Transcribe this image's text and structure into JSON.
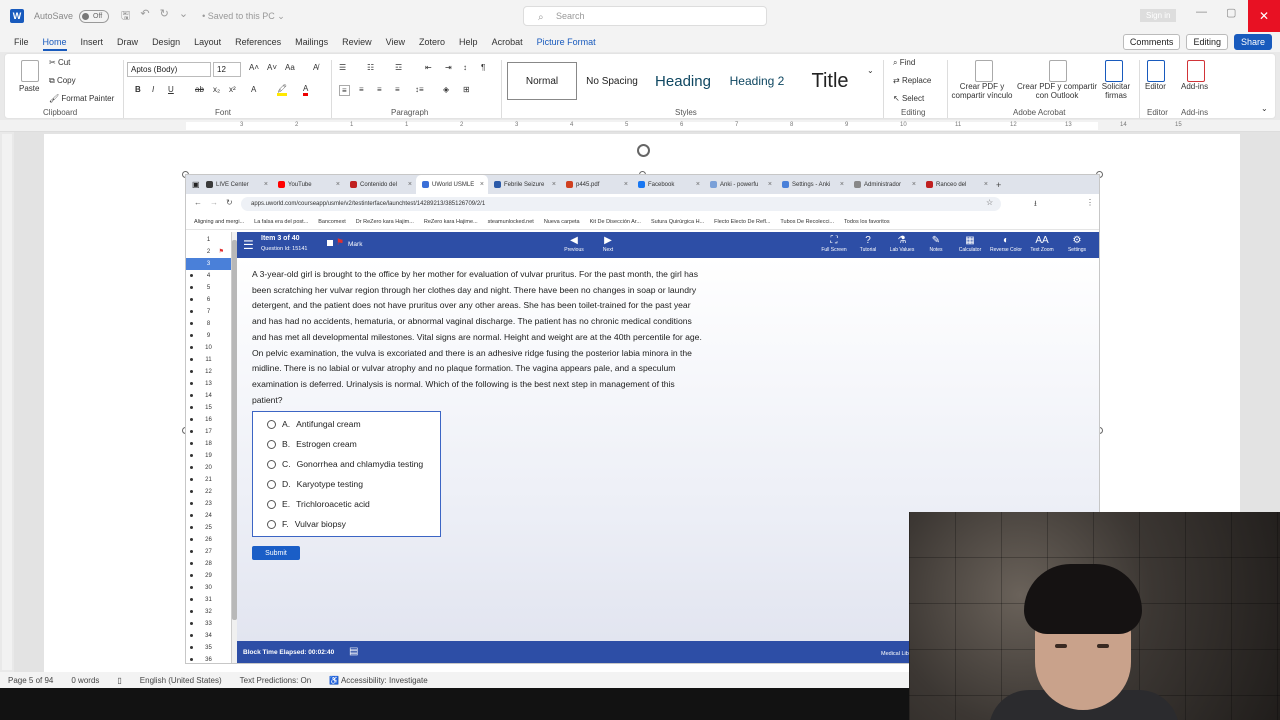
{
  "titlebar": {
    "autosave_label": "AutoSave",
    "toggle_state": "Off",
    "saved_status": "• Saved to this PC ⌄",
    "search_placeholder": "Search",
    "signin": "Sign in"
  },
  "menu": {
    "tabs": [
      "File",
      "Home",
      "Insert",
      "Draw",
      "Design",
      "Layout",
      "References",
      "Mailings",
      "Review",
      "View",
      "Zotero",
      "Help",
      "Acrobat",
      "Picture Format"
    ],
    "active_tab": "Home",
    "comments": "Comments",
    "editing": "Editing",
    "share": "Share"
  },
  "ribbon": {
    "clipboard": {
      "label": "Clipboard",
      "paste": "Paste",
      "cut": "Cut",
      "copy": "Copy",
      "format_painter": "Format Painter"
    },
    "font": {
      "label": "Font",
      "family": "Aptos (Body)",
      "size": "12"
    },
    "paragraph": {
      "label": "Paragraph"
    },
    "styles": {
      "label": "Styles",
      "items": [
        "Normal",
        "No Spacing",
        "Heading",
        "Heading 2",
        "Title"
      ]
    },
    "editing": {
      "label": "Editing",
      "find": "Find",
      "replace": "Replace",
      "select": "Select"
    },
    "adobe": {
      "label": "Adobe Acrobat",
      "create_share": "Crear PDF y compartir vínculo",
      "create_outlook": "Crear PDF y compartir con Outlook",
      "request_sign": "Solicitar firmas"
    },
    "editor": {
      "label": "Editor",
      "button": "Editor"
    },
    "addins": {
      "label": "Add-ins",
      "button": "Add-ins"
    }
  },
  "ruler_numbers": [
    "3",
    "2",
    "1",
    "1",
    "2",
    "3",
    "4",
    "5",
    "6",
    "7",
    "8",
    "9",
    "10",
    "11",
    "12",
    "13",
    "14",
    "15"
  ],
  "browser": {
    "tabs": [
      "LIVE Center",
      "YouTube",
      "Contenido del",
      "UWorld USMLE",
      "Febrile Seizure",
      "p445.pdf",
      "Facebook",
      "Anki - powerfu",
      "Settings - Anki",
      "Administrador",
      "Ranceo del"
    ],
    "active_tab_index": 3,
    "url": "apps.uworld.com/courseapp/usmle/v2/testinterface/launchtest/14289213/385126709/2/1",
    "bookmarks": [
      "Aligning and mergi...",
      "La falsa era del post...",
      "Bancomext",
      "Dr ReZero kara Hajim...",
      "ReZero kara Hajime...",
      "steamunlocked.net",
      "Nueva carpeta",
      "Kit De Disección Ar...",
      "Sutura Quirúrgica H...",
      "Flecto Electo De Refl...",
      "Tubos De Recolecci...",
      "Todos los favoritos"
    ]
  },
  "uworld": {
    "item_label": "Item 3 of 40",
    "question_id": "Question Id: 15141",
    "mark": "Mark",
    "previous": "Previous",
    "next": "Next",
    "tools": [
      "Full Screen",
      "Tutorial",
      "Lab Values",
      "Notes",
      "Calculator",
      "Reverse Color",
      "Text Zoom",
      "Settings"
    ],
    "question_numbers": [
      "1",
      "2",
      "3",
      "4",
      "5",
      "6",
      "7",
      "8",
      "9",
      "10",
      "11",
      "12",
      "13",
      "14",
      "15",
      "16",
      "17",
      "18",
      "19",
      "20",
      "21",
      "22",
      "23",
      "24",
      "25",
      "26",
      "27",
      "28",
      "29",
      "30",
      "31",
      "32",
      "33",
      "34",
      "35",
      "36"
    ],
    "current_question": 3,
    "stem": "A 3-year-old girl is brought to the office by her mother for evaluation of vulvar pruritus.  For the past month, the girl has been scratching her vulvar region through her clothes day and night.  There have been no changes in soap or laundry detergent, and the patient does not have pruritus over any other areas.  She has been toilet-trained for the past year and has had no accidents, hematuria, or abnormal vaginal discharge.  The patient has no chronic medical conditions and has met all developmental milestones.  Vital signs are normal.  Height and weight are at the 40th percentile for age.  On pelvic examination, the vulva is excoriated and there is an adhesive ridge fusing the posterior labia minora in the midline.  There is no labial or vulvar atrophy and no plaque formation.  The vagina appears pale, and a speculum examination is deferred.  Urinalysis is normal.  Which of the following is the best next step in management of this patient?",
    "choices": [
      {
        "letter": "A.",
        "text": "Antifungal cream"
      },
      {
        "letter": "B.",
        "text": "Estrogen cream"
      },
      {
        "letter": "C.",
        "text": "Gonorrhea and chlamydia testing"
      },
      {
        "letter": "D.",
        "text": "Karyotype testing"
      },
      {
        "letter": "E.",
        "text": "Trichloroacetic acid"
      },
      {
        "letter": "F.",
        "text": "Vulvar biopsy"
      }
    ],
    "submit": "Submit",
    "block_time": "Block Time Elapsed: 00:02:40",
    "medical_library": "Medical Lib"
  },
  "statusbar": {
    "page": "Page 5 of 94",
    "words": "0 words",
    "language": "English (United States)",
    "text_predictions": "Text Predictions: On",
    "accessibility": "Accessibility: Investigate"
  },
  "colors": {
    "word_blue": "#185abd",
    "uworld_blue": "#2d4ea6",
    "close_red": "#e81123"
  }
}
